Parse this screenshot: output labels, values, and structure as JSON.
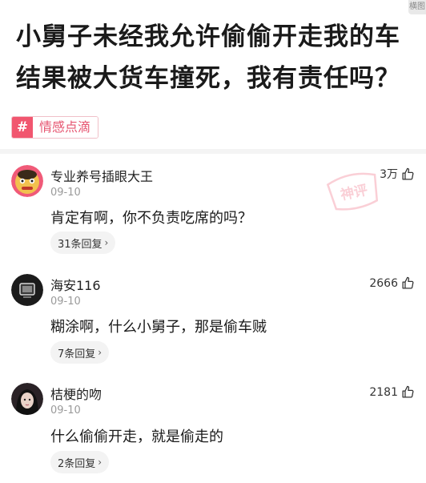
{
  "corner_tag": "横图",
  "title": "小舅子未经我允许偷偷开走我的车结果被大货车撞死，我有责任吗？",
  "topic": {
    "icon": "hash-icon",
    "label": "情感点滴"
  },
  "watermark_text": "神评",
  "comments": [
    {
      "username": "专业养号插眼大王",
      "date": "09-10",
      "likes": "3万",
      "text": "肯定有啊，你不负责吃席的吗？",
      "replies": "31条回复"
    },
    {
      "username": "海安116",
      "date": "09-10",
      "likes": "2666",
      "text": "糊涂啊，什么小舅子，那是偷车贼",
      "replies": "7条回复"
    },
    {
      "username": "桔梗的吻",
      "date": "09-10",
      "likes": "2181",
      "text": "什么偷偷开走，就是偷走的",
      "replies": "2条回复"
    }
  ],
  "colors": {
    "accent": "#f1566f",
    "stamp": "#f6a8b6"
  }
}
